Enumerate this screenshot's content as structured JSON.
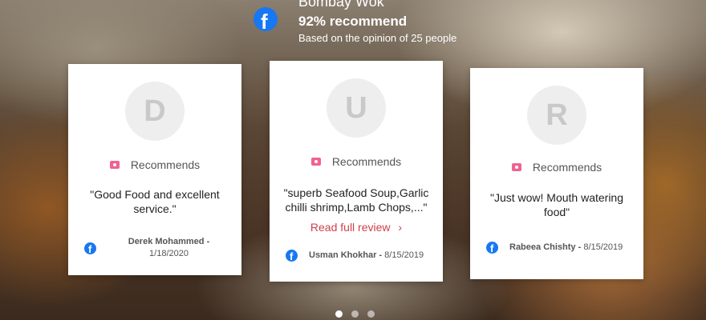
{
  "header": {
    "business_name": "Bombay Wok",
    "recommend_percent": "92% recommend",
    "basis": "Based on the opinion of 25 people",
    "icon": "facebook-icon"
  },
  "reviews": [
    {
      "initial": "D",
      "badge": "Recommends",
      "quote": "\"Good Food and excellent service.\"",
      "author": "Derek Mohammed",
      "date": "1/18/2020"
    },
    {
      "initial": "U",
      "badge": "Recommends",
      "quote": "\"superb Seafood Soup,Garlic chilli shrimp,Lamb Chops,...\"",
      "read_more": "Read full review",
      "author": "Usman Khokhar",
      "date": "8/15/2019"
    },
    {
      "initial": "R",
      "badge": "Recommends",
      "quote": "\"Just wow! Mouth watering food\"",
      "author": "Rabeea Chishty",
      "date": "8/15/2019"
    }
  ],
  "pagination": {
    "pages": 3,
    "active": 1
  },
  "colors": {
    "facebook": "#1877f2",
    "accent": "#d0404a",
    "badge": "#f06292"
  }
}
